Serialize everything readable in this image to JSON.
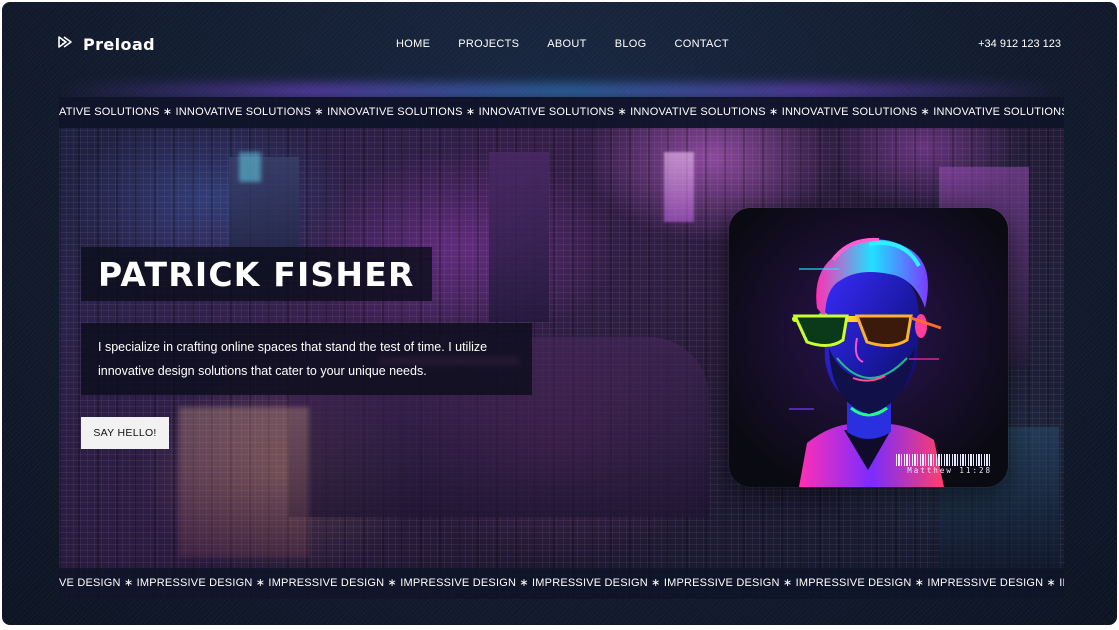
{
  "brand": {
    "name": "Preload",
    "logo_icon": "play-double-arrow-icon"
  },
  "nav": {
    "items": [
      {
        "label": "HOME"
      },
      {
        "label": "PROJECTS"
      },
      {
        "label": "ABOUT"
      },
      {
        "label": "BLOG"
      },
      {
        "label": "CONTACT"
      }
    ]
  },
  "header": {
    "phone": "+34 912 123 123"
  },
  "marquee_top": {
    "text": "ATIVE SOLUTIONS ∗ INNOVATIVE SOLUTIONS ∗ INNOVATIVE SOLUTIONS ∗ INNOVATIVE SOLUTIONS ∗ INNOVATIVE SOLUTIONS ∗ INNOVATIVE SOLUTIONS ∗ INNOVATIVE SOLUTIONS ∗ INNOVATIVE SOLUTIONS ∗ INNOVATIVE SOLUTIO"
  },
  "hero": {
    "name": "PATRICK FISHER",
    "description": "I specialize in crafting online spaces that stand the test of time. I utilize innovative design solutions that cater to your unique needs.",
    "cta_label": "SAY HELLO!",
    "background": "neon-cyberpunk-city-aerial-image",
    "portrait": "neon-bearded-man-with-sunglasses-illustration",
    "portrait_caption": "Matthew 11:28"
  },
  "marquee_bottom": {
    "text": "VE DESIGN ∗ IMPRESSIVE DESIGN ∗ IMPRESSIVE DESIGN ∗ IMPRESSIVE DESIGN ∗ IMPRESSIVE DESIGN ∗ IMPRESSIVE DESIGN ∗ IMPRESSIVE DESIGN ∗ IMPRESSIVE DESIGN ∗ IMPRESSIVE DESIGN ∗ IMPRESSI"
  },
  "colors": {
    "page_bg": "#111a2c",
    "text": "#ffffff",
    "button_bg": "#f2f2f2",
    "neon_magenta": "#e64bff",
    "neon_cyan": "#3ab8ff"
  }
}
